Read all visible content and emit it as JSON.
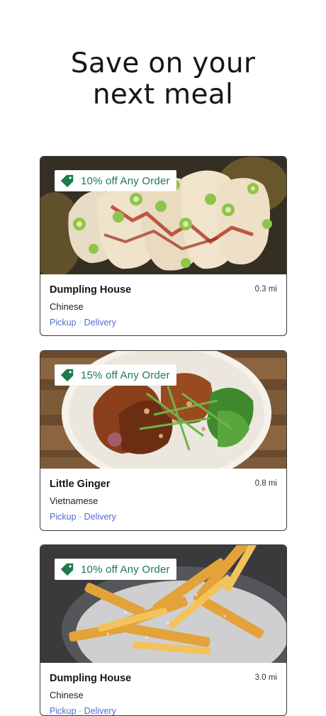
{
  "header": {
    "title_line1": "Save on your",
    "title_line2": "next meal"
  },
  "colors": {
    "promo_green": "#1d7a4c",
    "link_blue": "#4e6fd2"
  },
  "restaurants": [
    {
      "promo": "10% off Any Order",
      "name": "Dumpling House",
      "distance": "0.3 mi",
      "cuisine": "Chinese",
      "modes": [
        "Pickup",
        "Delivery"
      ],
      "separator": "·",
      "image": "dumplings-photo"
    },
    {
      "promo": "15% off Any Order",
      "name": "Little Ginger",
      "distance": "0.8 mi",
      "cuisine": "Vietnamese",
      "modes": [
        "Pickup",
        "Delivery"
      ],
      "separator": "·",
      "image": "chicken-salad-photo"
    },
    {
      "promo": "10% off Any Order",
      "name": "Dumpling House",
      "distance": "3.0 mi",
      "cuisine": "Chinese",
      "modes": [
        "Pickup",
        "Delivery"
      ],
      "separator": "·",
      "image": "fries-photo"
    }
  ]
}
